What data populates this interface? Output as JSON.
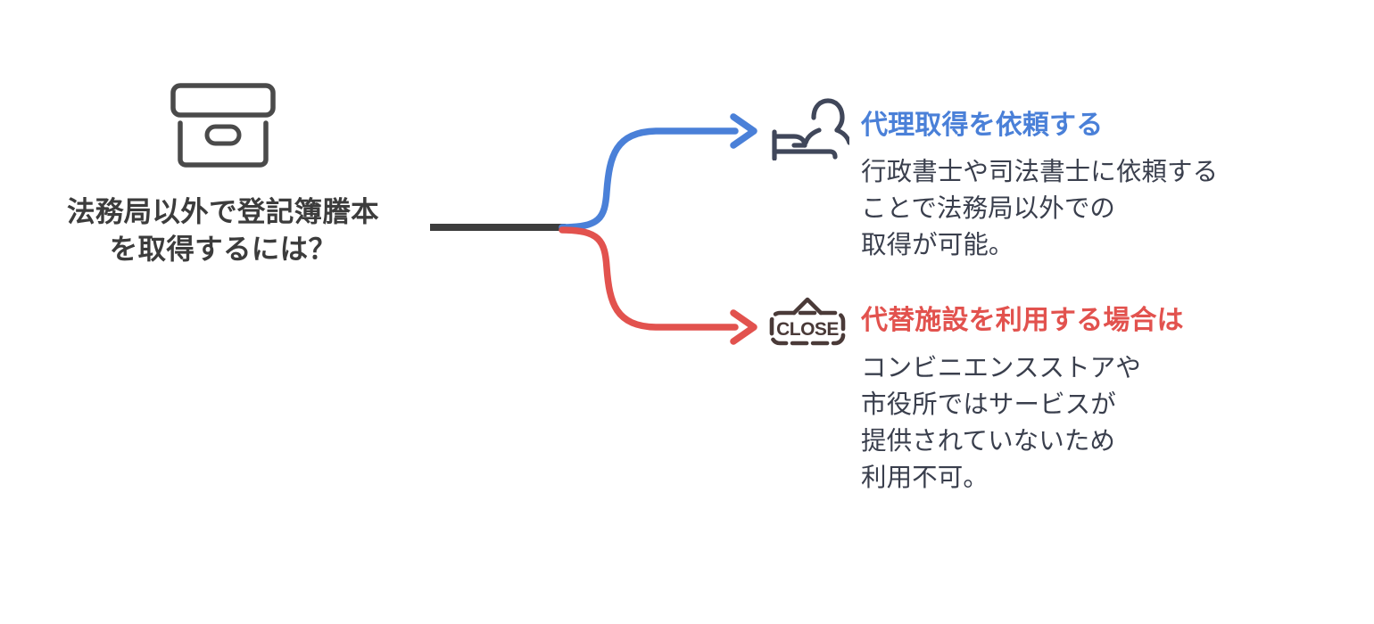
{
  "diagram": {
    "type": "branching-mindmap",
    "background_color": "#ffffff",
    "root": {
      "icon": "archive-box-icon",
      "title": "法務局以外で登記簿謄本\nを取得するには？",
      "title_color": "#3c3c3c",
      "stem_color": "#3d3d3d"
    },
    "branches": [
      {
        "id": "request",
        "icon": "person-request-icon",
        "heading": "代理取得を依頼する",
        "heading_color": "#4a80d8",
        "connector_color": "#4a80d8",
        "description": "行政書士や司法書士に依頼する\nことで法務局以外での\n取得が可能。",
        "description_color": "#3a3f4d"
      },
      {
        "id": "alternative",
        "icon": "close-sign-icon",
        "heading": "代替施設を利用する場合は",
        "heading_color": "#e2524e",
        "connector_color": "#e2524e",
        "description": "コンビニエンスストアや\n市役所ではサービスが\n提供されていないため\n利用不可。",
        "description_color": "#3a3f4d"
      }
    ]
  }
}
